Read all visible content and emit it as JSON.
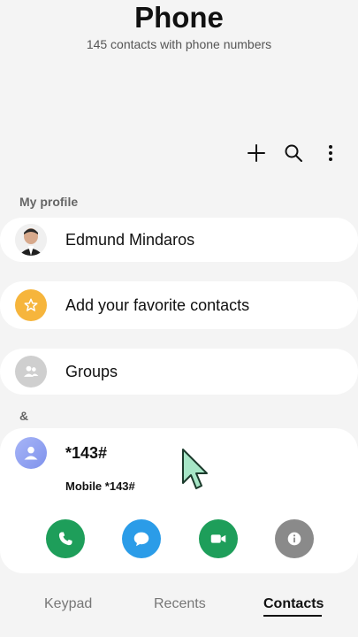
{
  "header": {
    "title": "Phone",
    "subtitle": "145 contacts with phone numbers"
  },
  "actions": {
    "add_icon": "plus-icon",
    "search_icon": "search-icon",
    "more_icon": "more-vertical-icon"
  },
  "my_profile": {
    "section_label": "My profile",
    "name": "Edmund Mindaros"
  },
  "favorites": {
    "label": "Add your favorite contacts",
    "color": "#f6b53c"
  },
  "groups": {
    "label": "Groups",
    "color": "#cfcfcf"
  },
  "contacts_section": {
    "label": "&"
  },
  "contact": {
    "name": "*143#",
    "detail": "Mobile *143#",
    "actions": [
      {
        "name": "call",
        "icon": "phone-icon",
        "color": "#1e9e5a"
      },
      {
        "name": "message",
        "icon": "message-icon",
        "color": "#2b9ce8"
      },
      {
        "name": "video",
        "icon": "video-icon",
        "color": "#1e9e5a"
      },
      {
        "name": "info",
        "icon": "info-icon",
        "color": "#8a8a8a"
      }
    ]
  },
  "tabs": [
    {
      "label": "Keypad",
      "active": false
    },
    {
      "label": "Recents",
      "active": false
    },
    {
      "label": "Contacts",
      "active": true
    }
  ]
}
